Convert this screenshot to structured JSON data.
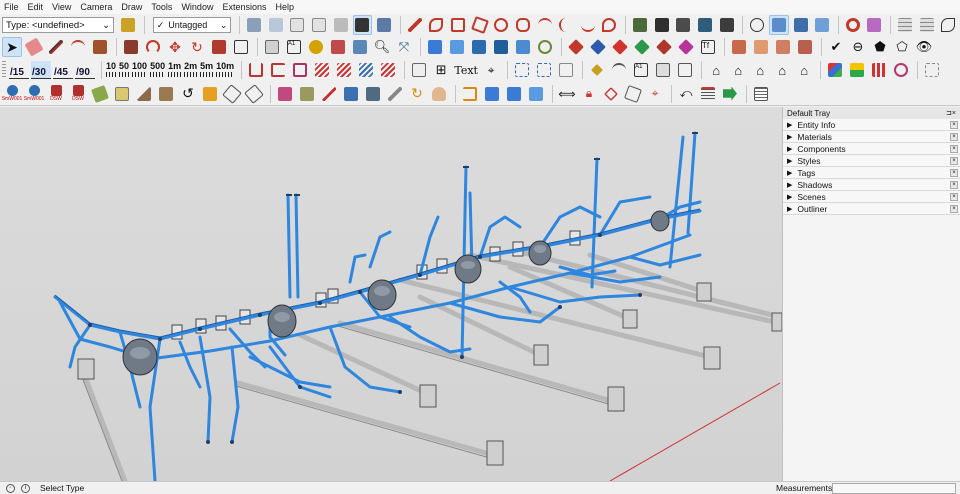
{
  "menu": [
    "File",
    "Edit",
    "View",
    "Camera",
    "Draw",
    "Tools",
    "Window",
    "Extensions",
    "Help"
  ],
  "toolbar": {
    "type_select": "Type: <undefined>",
    "tag_select": "Untagged",
    "scales": [
      "/15",
      "/30",
      "/45",
      "/90"
    ],
    "rulers": [
      "10",
      "50",
      "100",
      "500",
      "1m",
      "2m",
      "5m",
      "10m"
    ],
    "text_tool": "Text",
    "row4_labels": [
      "SmW001",
      "SmW001",
      "DSW",
      "DSW"
    ]
  },
  "tray": {
    "title": "Default Tray",
    "panels": [
      "Entity Info",
      "Materials",
      "Components",
      "Styles",
      "Tags",
      "Shadows",
      "Scenes",
      "Outliner"
    ]
  },
  "status": {
    "hint": "Select Type",
    "measurements_label": "Measurements"
  },
  "colors": {
    "pipe_blue": "#2e86de",
    "ground": "#d6d6d6",
    "gray_pipe": "#b8b8b8",
    "axis_red": "#d03030"
  }
}
